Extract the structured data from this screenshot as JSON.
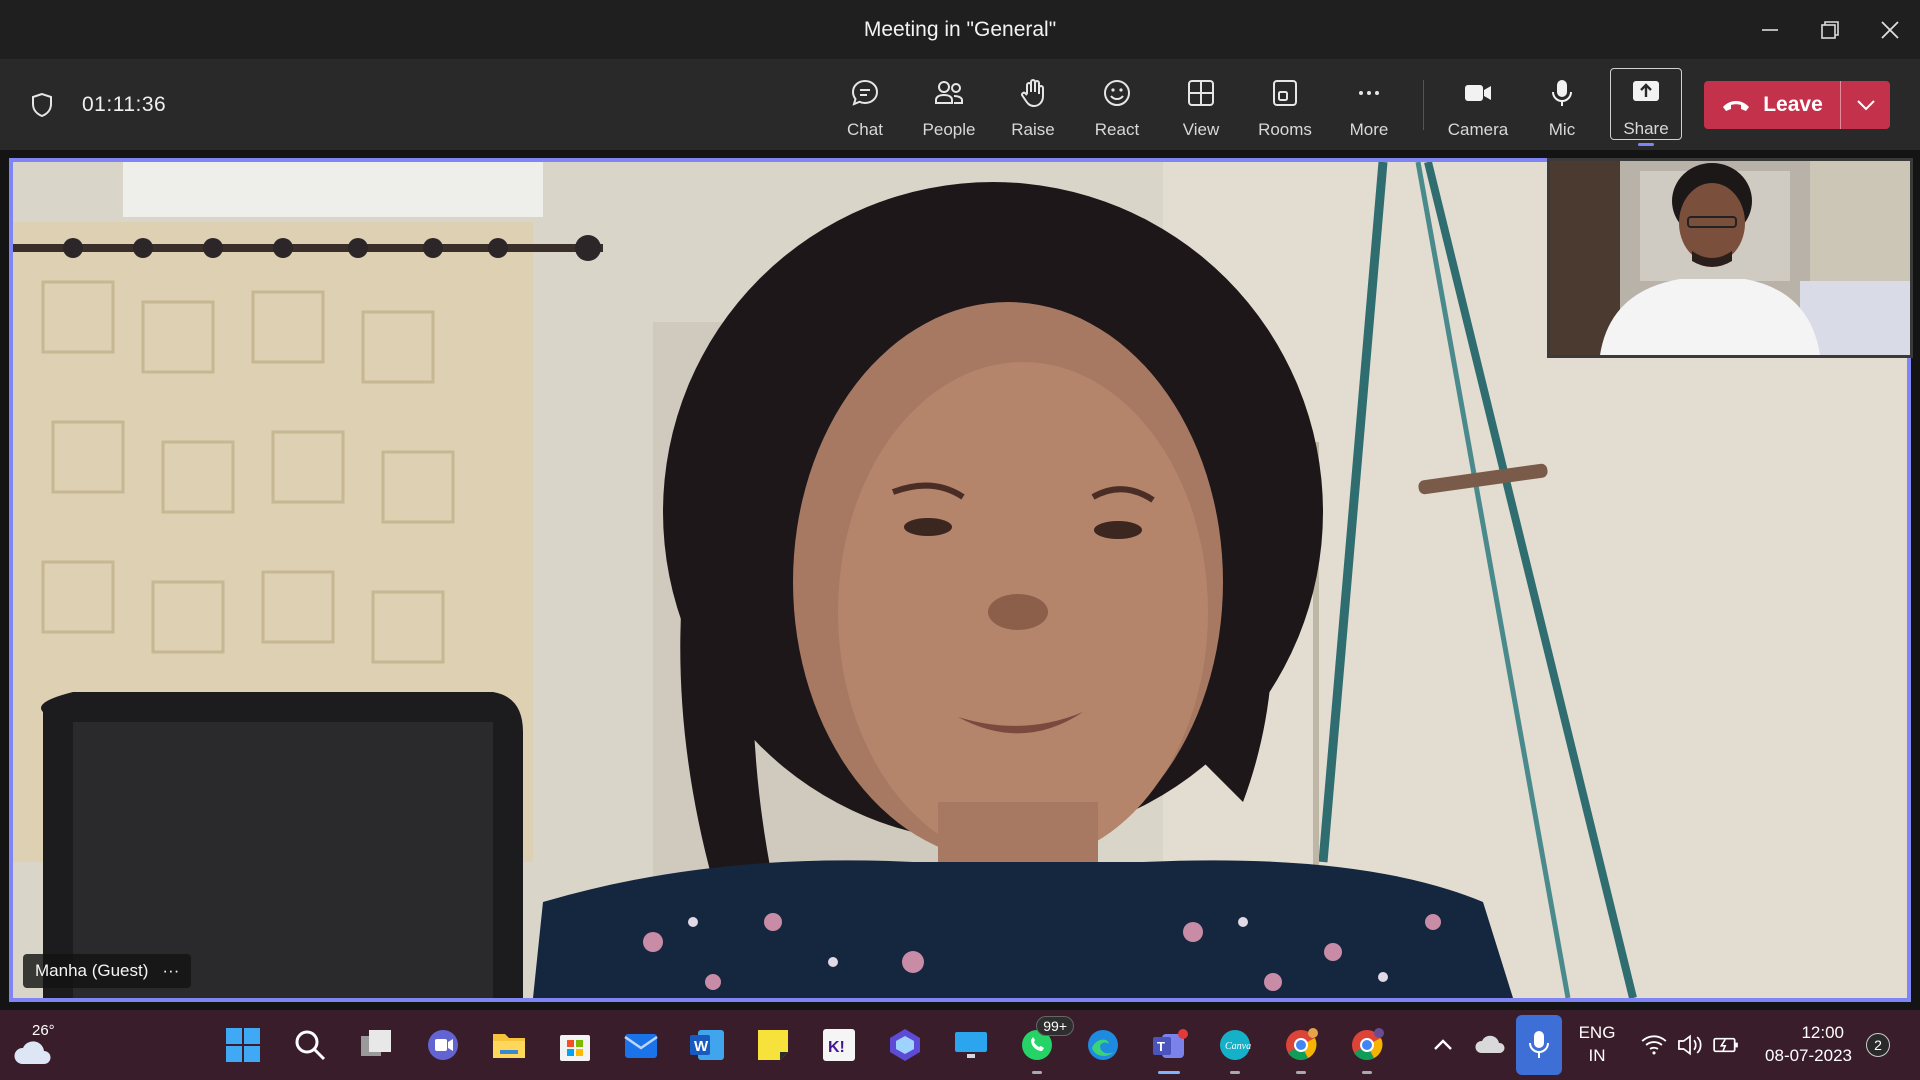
{
  "window": {
    "title": "Meeting in \"General\"",
    "controls": {
      "minimize": "minimize-icon",
      "restore": "restore-icon",
      "close": "close-icon"
    }
  },
  "toolbar": {
    "timer": "01:11:36",
    "buttons": [
      {
        "label": "Chat",
        "icon": "chat-icon"
      },
      {
        "label": "People",
        "icon": "people-icon"
      },
      {
        "label": "Raise",
        "icon": "raise-hand-icon"
      },
      {
        "label": "React",
        "icon": "react-smiley-icon"
      },
      {
        "label": "View",
        "icon": "view-grid-icon"
      },
      {
        "label": "Rooms",
        "icon": "rooms-icon"
      },
      {
        "label": "More",
        "icon": "more-icon"
      },
      {
        "label": "Camera",
        "icon": "camera-icon"
      },
      {
        "label": "Mic",
        "icon": "mic-icon"
      },
      {
        "label": "Share",
        "icon": "share-icon"
      }
    ],
    "leave_label": "Leave"
  },
  "stage": {
    "main_participant": "Manha (Guest)",
    "badge_more": "···"
  },
  "taskbar": {
    "weather_temp": "26°",
    "whatsapp_badge": "99+",
    "lang_line1": "ENG",
    "lang_line2": "IN",
    "time": "12:00",
    "date": "08-07-2023",
    "notifications": "2"
  },
  "colors": {
    "accent": "#7f85f5",
    "leave": "#c4314b",
    "taskbar": "#3a1d2a",
    "toolbar": "#292929"
  }
}
